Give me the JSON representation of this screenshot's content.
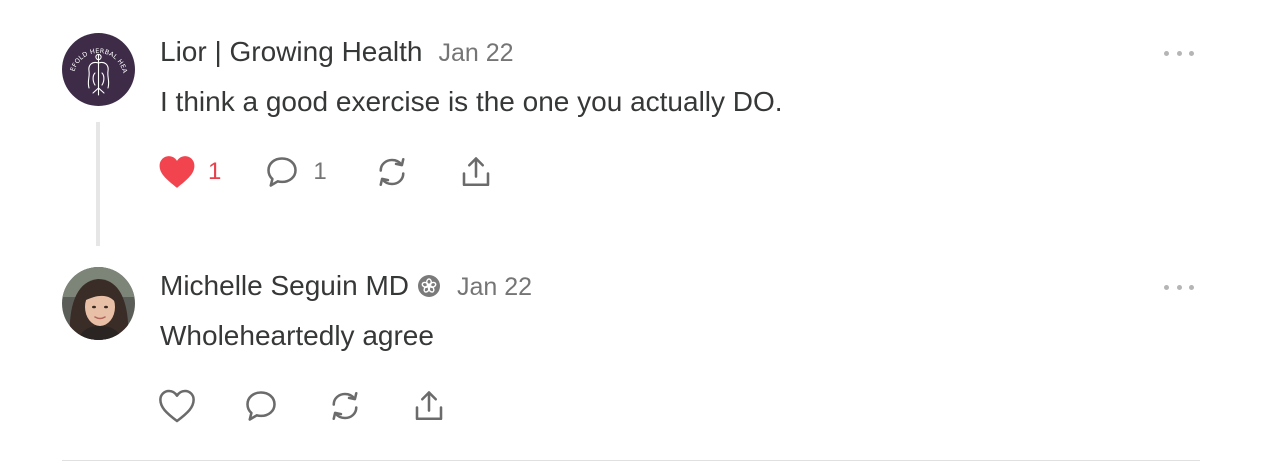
{
  "comments": [
    {
      "author": "Lior | Growing Health",
      "date": "Jan 22",
      "text": "I think a good exercise is the one you actually DO.",
      "avatar_text": "THREEFOLD HERBAL HEALING",
      "avatar_bg": "#3d2b47",
      "liked": true,
      "like_count": "1",
      "reply_count": "1",
      "verified": false
    },
    {
      "author": "Michelle Seguin MD",
      "date": "Jan 22",
      "text": "Wholeheartedly agree",
      "liked": false,
      "verified": true
    }
  ],
  "colors": {
    "heart": "#f2444f",
    "icon": "#6b6b6b",
    "muted": "#757575",
    "text": "#363737"
  },
  "icons": [
    "heart-icon",
    "comment-icon",
    "restack-icon",
    "share-icon",
    "more-icon",
    "verified-badge-icon"
  ]
}
